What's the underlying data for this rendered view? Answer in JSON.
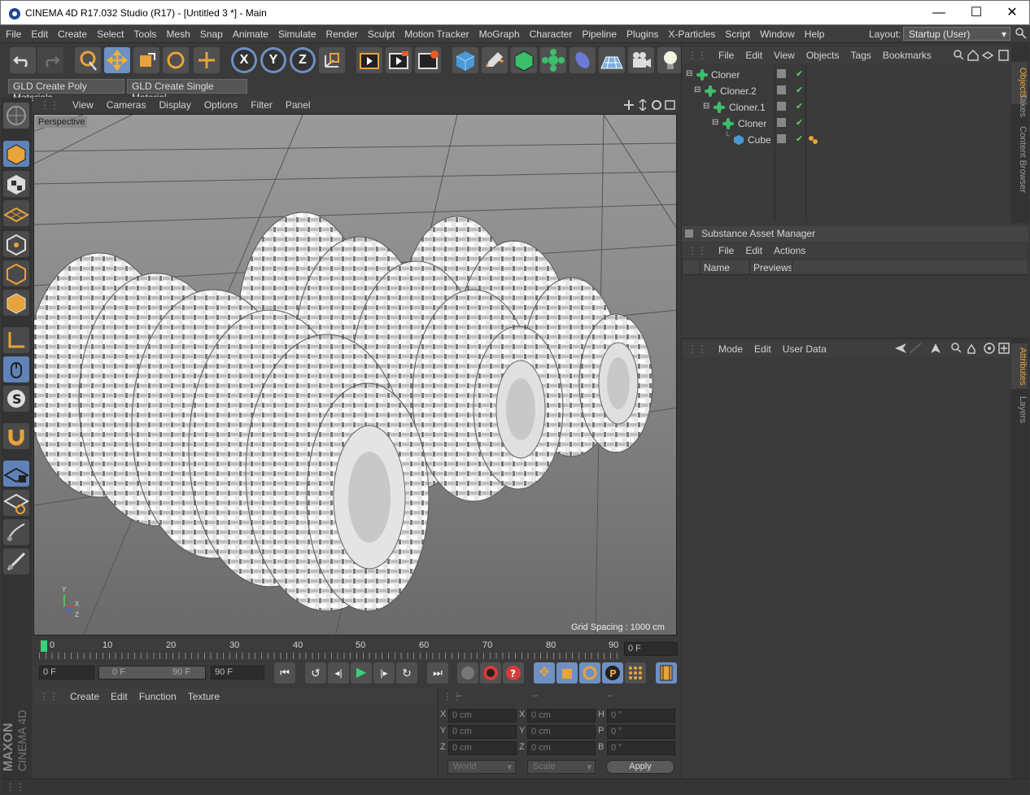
{
  "window": {
    "title": "CINEMA 4D R17.032 Studio (R17) - [Untitled 3 *] - Main",
    "minimize": "—",
    "maximize": "☐",
    "close": "✕"
  },
  "menubar": {
    "items": [
      "File",
      "Edit",
      "Create",
      "Select",
      "Tools",
      "Mesh",
      "Snap",
      "Animate",
      "Simulate",
      "Render",
      "Sculpt",
      "Motion Tracker",
      "MoGraph",
      "Character",
      "Pipeline",
      "Plugins",
      "X-Particles",
      "Script",
      "Window",
      "Help"
    ],
    "layout_label": "Layout:",
    "layout_value": "Startup (User)"
  },
  "toolbar": {
    "axis_x": "X",
    "axis_y": "Y",
    "axis_z": "Z",
    "gld_poly": "GLD Create Poly Materials",
    "gld_single": "GLD Create Single Material"
  },
  "viewport": {
    "menu": [
      "View",
      "Cameras",
      "Display",
      "Options",
      "Filter",
      "Panel"
    ],
    "label": "Perspective",
    "grid_spacing": "Grid Spacing : 1000 cm",
    "axis_x": "X",
    "axis_y": "Y",
    "axis_z": "Z"
  },
  "timeline": {
    "ticks": [
      "0",
      "10",
      "20",
      "30",
      "40",
      "50",
      "60",
      "70",
      "80",
      "90"
    ],
    "current_frame": "0 F",
    "start_frame": "0 F",
    "range_start": "0 F",
    "range_end": "90 F",
    "end_frame": "90 F"
  },
  "material_manager": {
    "menu": [
      "Create",
      "Edit",
      "Function",
      "Texture"
    ]
  },
  "coordinates": {
    "headers": [
      "--",
      "--",
      "--"
    ],
    "rows": [
      {
        "a": "X",
        "av": "0 cm",
        "b": "X",
        "bv": "0 cm",
        "c": "H",
        "cv": "0 °"
      },
      {
        "a": "Y",
        "av": "0 cm",
        "b": "Y",
        "bv": "0 cm",
        "c": "P",
        "cv": "0 °"
      },
      {
        "a": "Z",
        "av": "0 cm",
        "b": "Z",
        "bv": "0 cm",
        "c": "B",
        "cv": "0 °"
      }
    ],
    "world": "World",
    "scale": "Scale",
    "apply": "Apply"
  },
  "object_manager": {
    "menu": [
      "File",
      "Edit",
      "View",
      "Objects",
      "Tags",
      "Bookmarks"
    ],
    "objects": [
      {
        "name": "Cloner",
        "indent": 0
      },
      {
        "name": "Cloner.2",
        "indent": 1
      },
      {
        "name": "Cloner.1",
        "indent": 2
      },
      {
        "name": "Cloner",
        "indent": 3
      },
      {
        "name": "Cube",
        "indent": 4
      }
    ],
    "tabs": [
      "Objects",
      "Takes",
      "Content Browser"
    ]
  },
  "substance": {
    "title": "Substance Asset Manager",
    "menu": [
      "File",
      "Edit",
      "Actions"
    ],
    "columns": [
      "Name",
      "Previews"
    ]
  },
  "attributes": {
    "menu": [
      "Mode",
      "Edit",
      "User Data"
    ],
    "tabs": [
      "Attributes",
      "Layers"
    ]
  },
  "brand": {
    "maxon": "MAXON",
    "cinema": "CINEMA 4D"
  },
  "colors": {
    "accent": "#6e90c2",
    "orange": "#e8a33a",
    "check": "#5fd35f"
  }
}
